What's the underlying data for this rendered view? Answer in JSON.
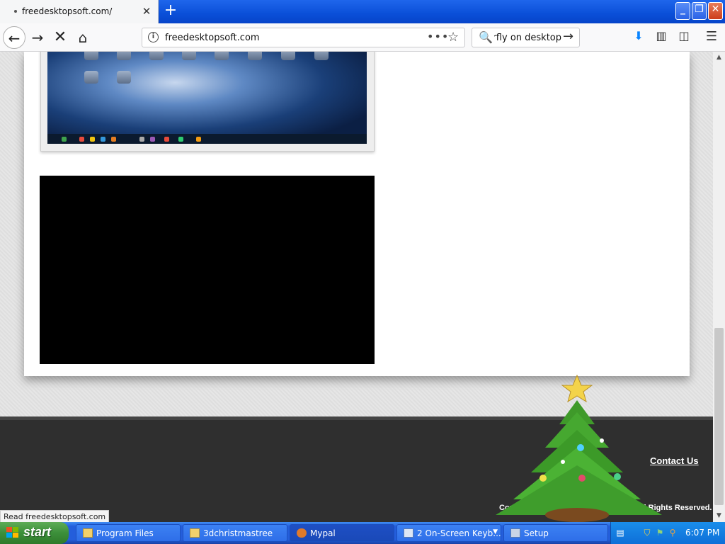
{
  "browser": {
    "tab_title": "freedesktopsoft.com/",
    "url": "freedesktopsoft.com",
    "search_query": "Butterfly on desktop"
  },
  "page": {
    "contact_label": "Contact Us",
    "copyright": "Copyright © 2013 Free Desktop Soft. All Rights Reserved.",
    "status_text": "Read freedesktopsoft.com"
  },
  "taskbar": {
    "start_label": "start",
    "tasks": [
      {
        "label": "Program Files"
      },
      {
        "label": "3dchristmastree"
      },
      {
        "label": "Mypal"
      },
      {
        "label": "2 On-Screen Keyb..."
      },
      {
        "label": "Setup"
      }
    ],
    "clock": "6:07 PM"
  },
  "colors": {
    "xp_blue": "#245edb",
    "start_green": "#3c8f3a",
    "footer_bg": "#2f2f2f",
    "download_accent": "#0a84ff"
  }
}
